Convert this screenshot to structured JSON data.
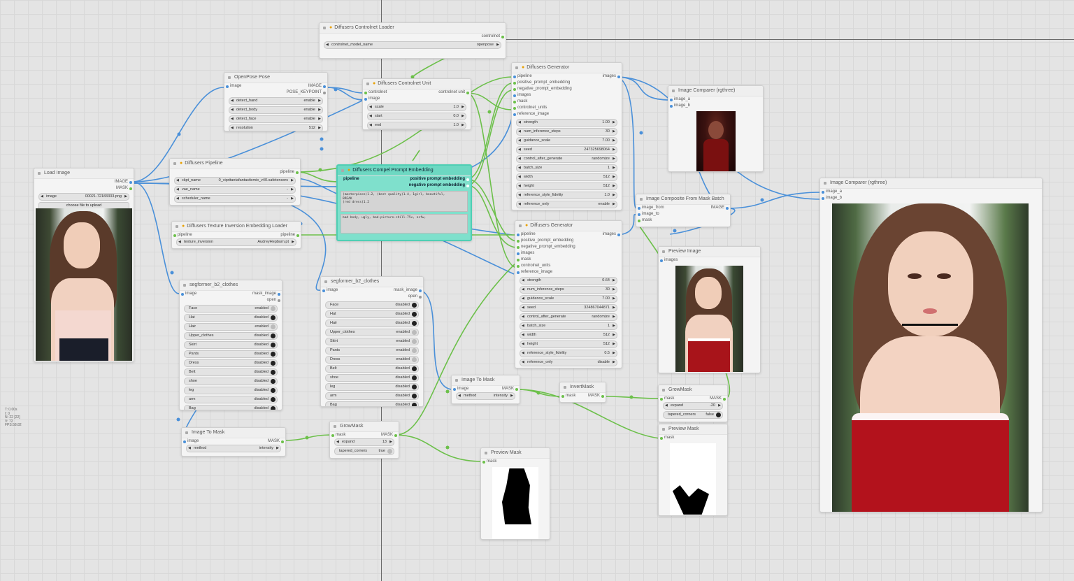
{
  "stats": [
    "T: 0.00s",
    "I: 0",
    "N: 22 [22]",
    "V: 72",
    "FPS:58.82"
  ],
  "controlnet_loader": {
    "title": "Diffusers Controlnet Loader",
    "out": "controlnet",
    "w_label": "controlnet_model_name",
    "w_value": "openpose"
  },
  "openpose": {
    "title": "OpenPose Pose",
    "in": "image",
    "out1": "IMAGE",
    "out2": "POSE_KEYPOINT",
    "widgets": [
      {
        "l": "detect_hand",
        "v": "enable"
      },
      {
        "l": "detect_body",
        "v": "enable"
      },
      {
        "l": "detect_face",
        "v": "enable"
      },
      {
        "l": "resolution",
        "v": "512"
      }
    ]
  },
  "controlnet_unit": {
    "title": "Diffusers Controlnet Unit",
    "in1": "controlnet",
    "in2": "image",
    "out": "controlnet unit",
    "widgets": [
      {
        "l": "scale",
        "v": "1.0"
      },
      {
        "l": "start",
        "v": "0.0"
      },
      {
        "l": "end",
        "v": "1.0"
      }
    ]
  },
  "gen1": {
    "title": "Diffusers Generator",
    "out": "images",
    "inputs": [
      "pipeline",
      "positive_prompt_embedding",
      "negative_prompt_embedding",
      "images",
      "mask",
      "controlnet_units",
      "reference_image"
    ],
    "widgets": [
      {
        "l": "strength",
        "v": "1.00"
      },
      {
        "l": "num_inference_steps",
        "v": "30"
      },
      {
        "l": "guidance_scale",
        "v": "7.00"
      },
      {
        "l": "seed",
        "v": "247325698064"
      },
      {
        "l": "control_after_generate",
        "v": "randomize"
      },
      {
        "l": "batch_size",
        "v": "1"
      },
      {
        "l": "width",
        "v": "512"
      },
      {
        "l": "height",
        "v": "512"
      },
      {
        "l": "reference_style_fidelity",
        "v": "1.0"
      },
      {
        "l": "reference_only",
        "v": "enable"
      },
      {
        "l": "reference_only_adain",
        "v": "disable"
      }
    ]
  },
  "gen2": {
    "title": "Diffusers Generator",
    "out": "images",
    "inputs": [
      "pipeline",
      "positive_prompt_embedding",
      "negative_prompt_embedding",
      "images",
      "mask",
      "controlnet_units",
      "reference_image"
    ],
    "widgets": [
      {
        "l": "strength",
        "v": "0.64"
      },
      {
        "l": "num_inference_steps",
        "v": "30"
      },
      {
        "l": "guidance_scale",
        "v": "7.00"
      },
      {
        "l": "seed",
        "v": "324867044871"
      },
      {
        "l": "control_after_generate",
        "v": "randomize"
      },
      {
        "l": "batch_size",
        "v": "1"
      },
      {
        "l": "width",
        "v": "512"
      },
      {
        "l": "height",
        "v": "512"
      },
      {
        "l": "reference_style_fidelity",
        "v": "0.5"
      },
      {
        "l": "reference_only",
        "v": "disable"
      },
      {
        "l": "reference_only_adain",
        "v": "disable"
      }
    ]
  },
  "comparer1": {
    "title": "Image Comparer (rgthree)",
    "in1": "image_a",
    "in2": "image_b"
  },
  "comparer2": {
    "title": "Image Comparer (rgthree)",
    "in1": "image_a",
    "in2": "image_b"
  },
  "load_image": {
    "title": "Load Image",
    "out1": "IMAGE",
    "out2": "MASK",
    "w_label": "image",
    "w_value": "00021-72183333.png",
    "upload": "choose file to upload"
  },
  "pipeline": {
    "title": "Diffusers Pipeline",
    "out": "pipeline",
    "widgets": [
      {
        "l": "ckpt_name",
        "v": "0_vipritantafantasticmix_v40.safetensors"
      },
      {
        "l": "vae_name",
        "v": "-"
      },
      {
        "l": "scheduler_name",
        "v": "-"
      }
    ]
  },
  "compel": {
    "title": "Diffusers Compel Prompt Embedding",
    "in": "pipeline",
    "out1": "positive prompt embedding",
    "out2": "negative prompt embedding",
    "pos": "(masterpiece)1.2, (best quality)1.4, 1girl, beautiful,\nBREAK\n(red dress)1.2",
    "neg": "bad body, ugly, bad-picture-chill-75v, nsfw,"
  },
  "texinv": {
    "title": "Diffusers Texture Inversion Embedding Loader",
    "in": "pipeline",
    "out": "pipeline",
    "w_label": "texture_inversion",
    "w_value": "AudreyHepburn.pt"
  },
  "composite": {
    "title": "Image Composite From Mask Batch",
    "in1": "image_from",
    "in2": "image_to",
    "in3": "mask",
    "out": "IMAGE"
  },
  "preview_image": {
    "title": "Preview Image",
    "in": "images"
  },
  "seg1": {
    "title": "segformer_b2_clothes",
    "in": "image",
    "out1": "mask_image",
    "out2": "open",
    "toggles": [
      {
        "l": "Face",
        "v": "enabled"
      },
      {
        "l": "Hat",
        "v": "disabled"
      },
      {
        "l": "Hair",
        "v": "enabled"
      },
      {
        "l": "Upper_clothes",
        "v": "disabled"
      },
      {
        "l": "Skirt",
        "v": "disabled"
      },
      {
        "l": "Pants",
        "v": "disabled"
      },
      {
        "l": "Dress",
        "v": "disabled"
      },
      {
        "l": "Belt",
        "v": "disabled"
      },
      {
        "l": "shoe",
        "v": "disabled"
      },
      {
        "l": "leg",
        "v": "disabled"
      },
      {
        "l": "arm",
        "v": "disabled"
      },
      {
        "l": "Bag",
        "v": "disabled"
      },
      {
        "l": "Scarf",
        "v": "disabled"
      }
    ]
  },
  "seg2": {
    "title": "segformer_b2_clothes",
    "in": "image",
    "out1": "mask_image",
    "out2": "open",
    "toggles": [
      {
        "l": "Face",
        "v": "disabled"
      },
      {
        "l": "Hat",
        "v": "disabled"
      },
      {
        "l": "Hair",
        "v": "disabled"
      },
      {
        "l": "Upper_clothes",
        "v": "enabled"
      },
      {
        "l": "Skirt",
        "v": "enabled"
      },
      {
        "l": "Pants",
        "v": "enabled"
      },
      {
        "l": "Dress",
        "v": "enabled"
      },
      {
        "l": "Belt",
        "v": "disabled"
      },
      {
        "l": "shoe",
        "v": "disabled"
      },
      {
        "l": "leg",
        "v": "disabled"
      },
      {
        "l": "arm",
        "v": "disabled"
      },
      {
        "l": "Bag",
        "v": "disabled"
      },
      {
        "l": "Scarf",
        "v": "disabled"
      }
    ]
  },
  "img2mask1": {
    "title": "Image To Mask",
    "in": "image",
    "out": "MASK",
    "w_label": "method",
    "w_value": "intensity"
  },
  "img2mask2": {
    "title": "Image To Mask",
    "in": "image",
    "out": "MASK",
    "w_label": "method",
    "w_value": "intensity"
  },
  "growmask1": {
    "title": "GrowMask",
    "in": "mask",
    "out": "MASK",
    "w1_label": "expand",
    "w1_value": "13",
    "w2_label": "tapered_corners",
    "w2_value": "true"
  },
  "growmask2": {
    "title": "GrowMask",
    "in": "mask",
    "out": "MASK",
    "w1_label": "expand",
    "w1_value": "-20",
    "w2_label": "tapered_corners",
    "w2_value": "false"
  },
  "invert": {
    "title": "InvertMask",
    "in": "mask",
    "out": "MASK"
  },
  "preview_mask1": {
    "title": "Preview Mask",
    "in": "mask"
  },
  "preview_mask2": {
    "title": "Preview Mask",
    "in": "mask"
  }
}
